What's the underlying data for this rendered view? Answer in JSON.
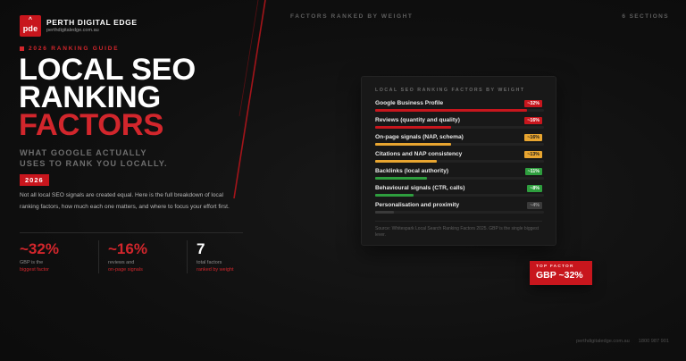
{
  "brand": {
    "name": "PERTH DIGITAL EDGE",
    "url": "perthdigitaledge.com.au",
    "logo_text": "pde"
  },
  "topbar": {
    "left": "FACTORS RANKED BY WEIGHT",
    "right": "6 SECTIONS"
  },
  "hero": {
    "eyebrow": "2026 RANKING GUIDE",
    "title_lines": [
      "LOCAL SEO",
      "RANKING",
      "FACTORS"
    ],
    "subtitle_lines": [
      "WHAT GOOGLE ACTUALLY",
      "USES TO RANK YOU LOCALLY."
    ],
    "year": "2026",
    "body": "Not all local SEO signals are created equal. Here is the full breakdown of local ranking factors, how much each one matters, and where to focus your effort first."
  },
  "stats": [
    {
      "value": "~32%",
      "line1": "GBP is the",
      "line2": "biggest factor"
    },
    {
      "value": "~16%",
      "line1": "reviews and",
      "line2": "on-page signals"
    },
    {
      "value": "7",
      "line1": "total factors",
      "line2": "ranked by weight"
    }
  ],
  "card": {
    "title": "LOCAL SEO RANKING FACTORS BY WEIGHT",
    "factors": [
      {
        "label": "Google Business Profile",
        "badge": "~32%",
        "weight": 32,
        "color": "#c8161d",
        "badge_text_color": "#ffffff"
      },
      {
        "label": "Reviews (quantity and quality)",
        "badge": "~16%",
        "weight": 16,
        "color": "#c8161d",
        "badge_text_color": "#ffffff"
      },
      {
        "label": "On-page signals (NAP, schema)",
        "badge": "~16%",
        "weight": 16,
        "color": "#e8a530",
        "badge_text_color": "#1a1a1a"
      },
      {
        "label": "Citations and NAP consistency",
        "badge": "~13%",
        "weight": 13,
        "color": "#e8a530",
        "badge_text_color": "#1a1a1a"
      },
      {
        "label": "Backlinks (local authority)",
        "badge": "~11%",
        "weight": 11,
        "color": "#2e9e3e",
        "badge_text_color": "#ffffff"
      },
      {
        "label": "Behavioural signals (CTR, calls)",
        "badge": "~8%",
        "weight": 8,
        "color": "#2e9e3e",
        "badge_text_color": "#ffffff"
      },
      {
        "label": "Personalisation and proximity",
        "badge": "~4%",
        "weight": 4,
        "color": "#3a3a3a",
        "badge_text_color": "#9a9a9a"
      }
    ],
    "source": "Source: Whitespark Local Search Ranking Factors 2025. GBP is the single biggest lever."
  },
  "top_factor": {
    "label": "TOP FACTOR",
    "value": "GBP ~32%"
  },
  "footer": {
    "url": "perthdigitaledge.com.au",
    "phone": "1800 987 901"
  },
  "colors": {
    "accent": "#c8161d",
    "amber": "#e8a530",
    "green": "#2e9e3e",
    "background": "#101010"
  }
}
